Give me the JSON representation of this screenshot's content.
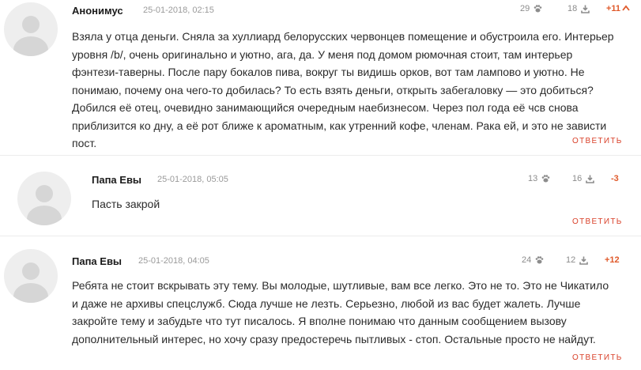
{
  "comments": [
    {
      "author": "Анонимус",
      "date": "25-01-2018, 02:15",
      "likes": "29",
      "dislikes": "18",
      "score": "+11",
      "text": "Взяла у отца деньги. Сняла за хуллиард белорусских червонцев помещение и обустроила его. Интерьер уровня /b/, очень оригинально и уютно, ага, да. У меня под домом рюмочная стоит, там интерьер фэнтези-таверны. После пару бокалов пива, вокруг ты видишь орков, вот там лампово и уютно. Не понимаю, почему она чего-то добилась? То есть взять деньги, открыть забегаловку — это добиться? Добился её отец, очевидно занимающийся очередным наебизнесом. Через пол года её чсв снова приблизится ко дну, а её рот ближе к ароматным, как утренний кофе, членам. Рака ей, и это не зависти пост.",
      "reply": "ответить"
    },
    {
      "author": "Папа Евы",
      "date": "25-01-2018, 05:05",
      "likes": "13",
      "dislikes": "16",
      "score": "-3",
      "text": "Пасть закрой",
      "reply": "ответить"
    },
    {
      "author": "Папа Евы",
      "date": "25-01-2018, 04:05",
      "likes": "24",
      "dislikes": "12",
      "score": "+12",
      "text": "Ребята не стоит вскрывать эту тему. Вы молодые, шутливые, вам все легко. Это не то. Это не Чикатило и даже не архивы спецслужб. Сюда лучше не лезть. Серьезно, любой из вас будет жалеть. Лучше закройте тему и забудьте что тут писалось. Я вполне понимаю что данным сообщением вызову дополнительный интерес, но хочу сразу предостеречь пытливых - стоп. Остальные просто не найдут.",
      "reply": "ответить"
    }
  ],
  "colors": {
    "score_positive": "#e05a2b",
    "score_negative": "#e05a2b",
    "reply": "#d9412a"
  },
  "icons": {
    "like": "paw-icon",
    "dislike": "download-tray-icon",
    "score_arrow": "chevron-up-icon"
  }
}
